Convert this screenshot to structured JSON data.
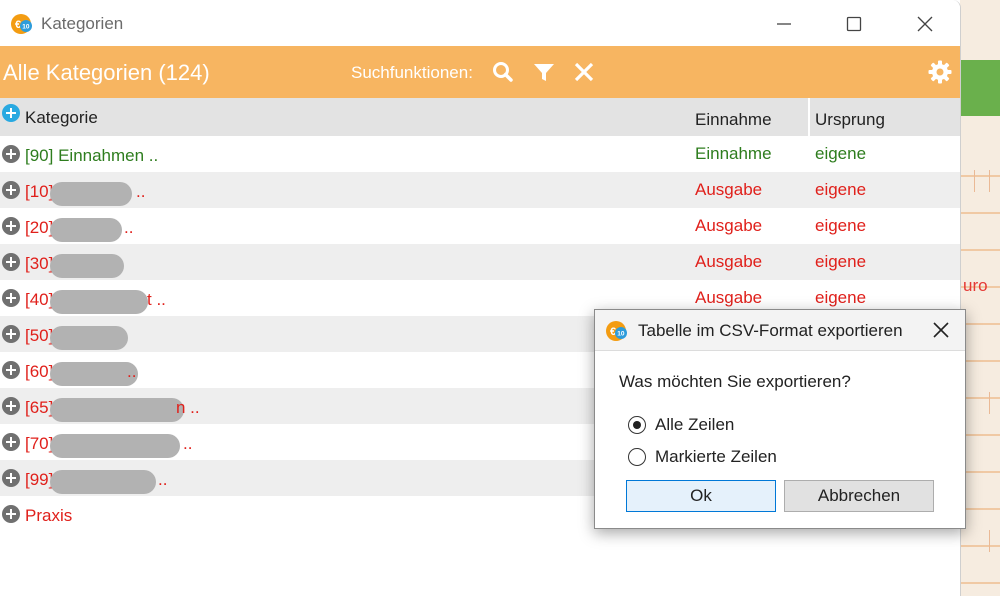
{
  "window": {
    "title": "Kategorien",
    "minimize_icon": "minimize-icon",
    "maximize_icon": "maximize-icon",
    "close_icon": "close-icon"
  },
  "header": {
    "title": "Alle Kategorien (124)",
    "search_label": "Suchfunktionen:",
    "icons": [
      "search-icon",
      "filter-icon",
      "clear-icon",
      "gear-icon"
    ],
    "accent": "#f7b561"
  },
  "table": {
    "columns": [
      "Kategorie",
      "Einnahme",
      "Ursprung"
    ],
    "rows": [
      {
        "kategorie": "[90] Einnahmen ..",
        "einnahme": "Einnahme",
        "ursprung": "eigene",
        "color": "#2e7d1e"
      },
      {
        "kategorie": "[10]",
        "suffix": "..",
        "einnahme": "Ausgabe",
        "ursprung": "eigene",
        "color": "#e0201b"
      },
      {
        "kategorie": "[20]",
        "suffix": "..",
        "einnahme": "Ausgabe",
        "ursprung": "eigene",
        "color": "#e0201b"
      },
      {
        "kategorie": "[30]",
        "suffix": "",
        "einnahme": "Ausgabe",
        "ursprung": "eigene",
        "color": "#e0201b"
      },
      {
        "kategorie": "[40]",
        "suffix": "t ..",
        "einnahme": "Ausgabe",
        "ursprung": "eigene",
        "color": "#e0201b"
      },
      {
        "kategorie": "[50]",
        "suffix": "",
        "einnahme": "",
        "ursprung": "",
        "color": "#e0201b"
      },
      {
        "kategorie": "[60]",
        "suffix": "..",
        "einnahme": "",
        "ursprung": "",
        "color": "#e0201b"
      },
      {
        "kategorie": "[65]",
        "suffix": "n ..",
        "einnahme": "",
        "ursprung": "",
        "color": "#e0201b"
      },
      {
        "kategorie": "[70]",
        "suffix": "..",
        "einnahme": "",
        "ursprung": "",
        "color": "#e0201b"
      },
      {
        "kategorie": "[99]",
        "suffix": "..",
        "einnahme": "",
        "ursprung": "",
        "color": "#e0201b"
      },
      {
        "kategorie": "Praxis",
        "suffix": "",
        "einnahme": "",
        "ursprung": "",
        "color": "#e0201b"
      }
    ]
  },
  "background": {
    "partial_text": "uro"
  },
  "dialog": {
    "title": "Tabelle im CSV-Format exportieren",
    "question": "Was möchten Sie exportieren?",
    "options": [
      {
        "label": "Alle Zeilen",
        "selected": true
      },
      {
        "label": "Markierte Zeilen",
        "selected": false
      }
    ],
    "ok_label": "Ok",
    "cancel_label": "Abbrechen"
  }
}
